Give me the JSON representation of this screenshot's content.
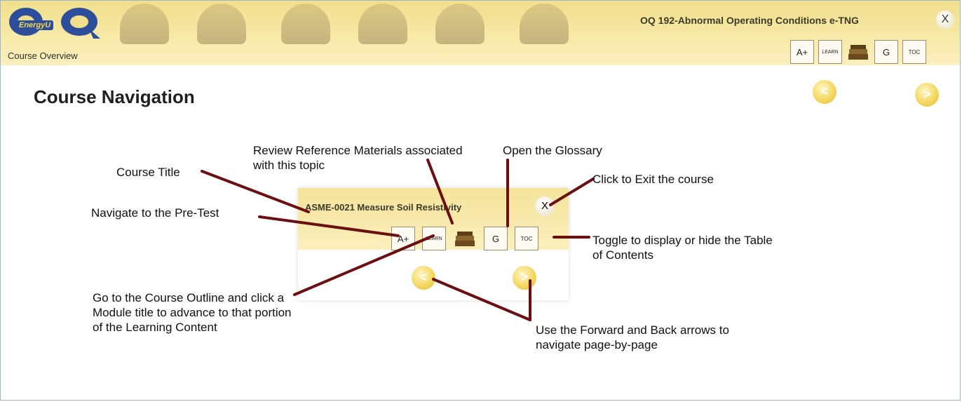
{
  "header": {
    "logo_text": "EnergyU",
    "course_title": "OQ 192-Abnormal Operating Conditions e-TNG",
    "exit_label": "X",
    "section": "Course Overview",
    "tools": [
      "A+",
      "LEARN",
      "books",
      "G",
      "TOC"
    ]
  },
  "page": {
    "title": "Course Navigation",
    "back": "<",
    "forward": ">"
  },
  "demo": {
    "title": "ASME-0021 Measure Soil Resistivity",
    "exit_label": "X"
  },
  "labels": {
    "course_title": "Course Title",
    "review": "Review Reference Materials associated with this topic",
    "glossary": "Open the Glossary",
    "exit": "Click to Exit the course",
    "pretest": "Navigate to the Pre-Test",
    "toc": "Toggle to display or hide the Table of Contents",
    "outline": "Go to the Course Outline and click a Module title to advance to that portion of the Learning Content",
    "arrows": "Use the Forward and Back arrows to navigate page-by-page"
  },
  "colors": {
    "header_yellow": "#f4e39a",
    "arrow_yellow": "#f2d55a",
    "callout_line": "#6b0f12",
    "logo_blue": "#2d4e9a"
  }
}
